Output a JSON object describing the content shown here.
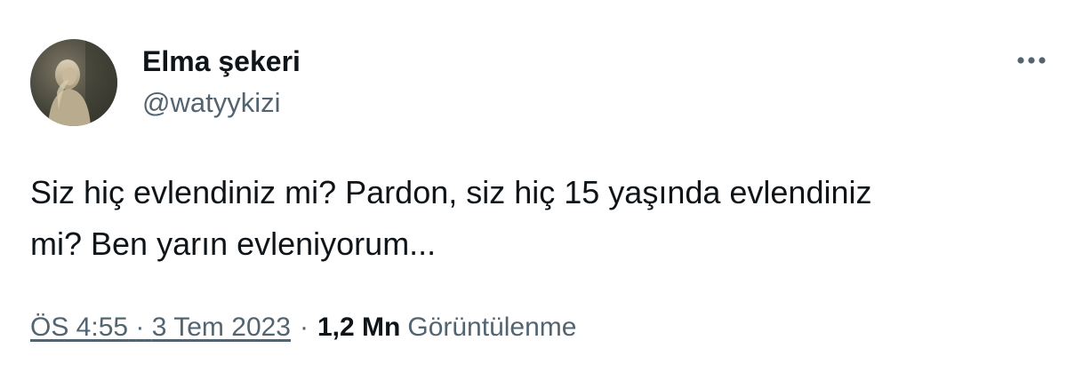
{
  "user": {
    "display_name": "Elma şekeri",
    "handle": "@watyykizi",
    "avatar_icon": "profile-photo"
  },
  "menu": {
    "more_icon": "more-horizontal-icon"
  },
  "tweet": {
    "text": "Siz hiç evlendiniz mi? Pardon, siz hiç 15 yaşında evlendiniz\nmi? Ben yarın evleniyorum..."
  },
  "meta": {
    "time": "ÖS 4:55",
    "dot_1": "·",
    "date": "3 Tem 2023",
    "dot_2": "·",
    "views_count": "1,2 Mn",
    "views_label": "Görüntülenme"
  },
  "colors": {
    "primary_text": "#0f1419",
    "secondary_text": "#536471",
    "background": "#ffffff"
  }
}
